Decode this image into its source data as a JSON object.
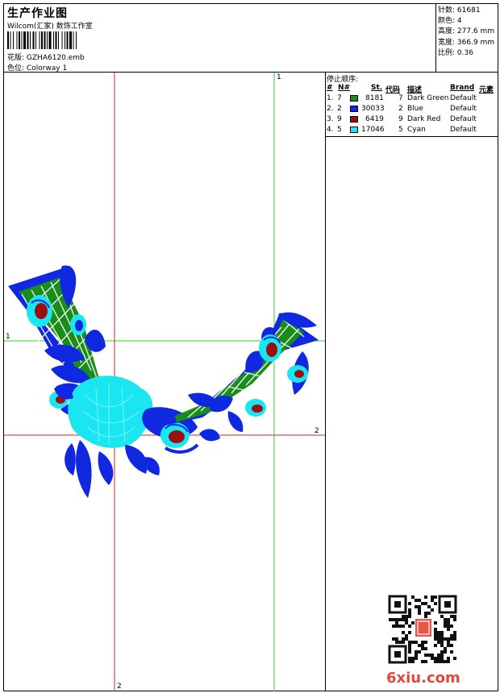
{
  "header": {
    "title": "生产作业图",
    "company": "Wilcom(汇家) 数饰工作室",
    "file_label": "花版:",
    "file_name": "GZHA6120.emb",
    "colorway_label": "色位:",
    "colorway": "Colorway 1"
  },
  "stats": {
    "stitches_label": "针数:",
    "stitches": "61681",
    "colors_label": "颜色:",
    "colors": "4",
    "height_label": "高度:",
    "height": "277.6 mm",
    "width_label": "宽度:",
    "width": "366.9 mm",
    "scale_label": "比例:",
    "scale": "0.36"
  },
  "stop_sequence": {
    "title": "停止顺序:",
    "columns": {
      "hash": "#",
      "no": "N#",
      "st": "St.",
      "code": "代码",
      "desc": "描述",
      "brand": "Brand",
      "element": "元素"
    },
    "rows": [
      {
        "idx": "1.",
        "n": "7",
        "st": "8181",
        "code": "7",
        "desc": "Dark Green",
        "brand": "Default",
        "color": "#1a8c1a"
      },
      {
        "idx": "2.",
        "n": "2",
        "st": "30033",
        "code": "2",
        "desc": "Blue",
        "brand": "Default",
        "color": "#1028e0"
      },
      {
        "idx": "3.",
        "n": "9",
        "st": "6419",
        "code": "9",
        "desc": "Dark Red",
        "brand": "Default",
        "color": "#9a1010"
      },
      {
        "idx": "4.",
        "n": "5",
        "st": "17046",
        "code": "5",
        "desc": "Cyan",
        "brand": "Default",
        "color": "#19e6f0"
      }
    ]
  },
  "axes": {
    "green_top": "1",
    "green_left": "1",
    "red_right": "2",
    "red_bottom": "2"
  },
  "watermark": "6xiu.com"
}
